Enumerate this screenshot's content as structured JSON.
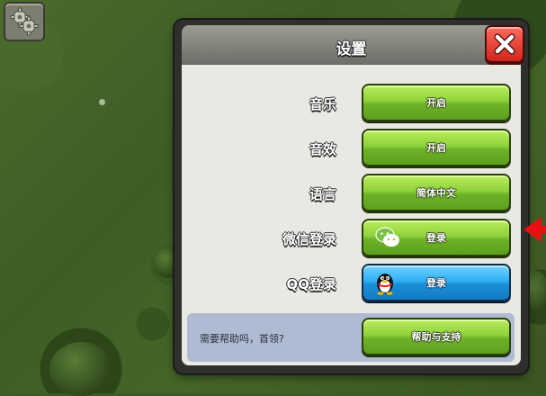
{
  "dialog": {
    "title": "设置",
    "close_icon": "close-x-icon"
  },
  "settings": [
    {
      "label": "音乐",
      "button": "开启",
      "style": "green"
    },
    {
      "label": "音效",
      "button": "开启",
      "style": "green"
    },
    {
      "label": "语言",
      "button": "简体中文",
      "style": "green"
    },
    {
      "label": "微信登录",
      "button": "登录",
      "style": "green",
      "icon": "wechat-icon"
    },
    {
      "label": "QQ登录",
      "button": "登录",
      "style": "blue",
      "icon": "qq-penguin-icon"
    }
  ],
  "help": {
    "text": "需要帮助吗，首领?",
    "button": "帮助与支持"
  },
  "hud": {
    "settings_icon": "gear-icon"
  },
  "colors": {
    "green_button": "#8fd33b",
    "blue_button": "#2fb0f5",
    "close_button": "#d1241c",
    "help_bar": "#aebbd2"
  }
}
